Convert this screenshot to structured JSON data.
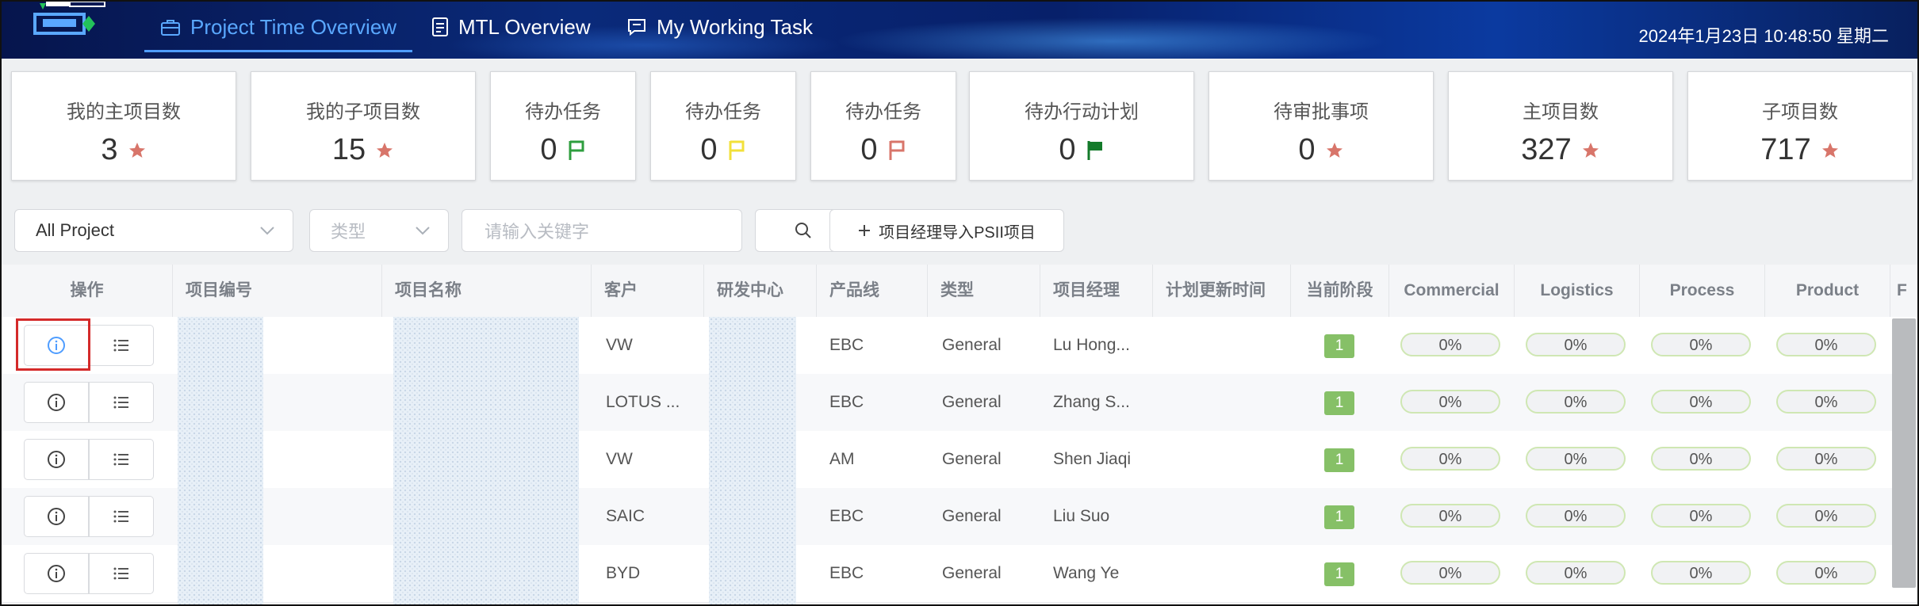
{
  "header": {
    "tabs": [
      {
        "label": "Project Time Overview",
        "icon": "briefcase-icon",
        "active": true
      },
      {
        "label": "MTL Overview",
        "icon": "document-icon",
        "active": false
      },
      {
        "label": "My Working Task",
        "icon": "chat-icon",
        "active": false
      }
    ],
    "datetime": "2024年1月23日  10:48:50  星期二"
  },
  "cards": [
    {
      "label": "我的主项目数",
      "value": "3",
      "icon": "star-icon",
      "color": "#d8756a"
    },
    {
      "label": "我的子项目数",
      "value": "15",
      "icon": "star-icon",
      "color": "#d8756a"
    },
    {
      "label": "待办任务",
      "value": "0",
      "icon": "flag-icon",
      "color": "#2e9e3e"
    },
    {
      "label": "待办任务",
      "value": "0",
      "icon": "flag-icon",
      "color": "#f2e03a"
    },
    {
      "label": "待办任务",
      "value": "0",
      "icon": "flag-icon",
      "color": "#d8756a"
    },
    {
      "label": "待办行动计划",
      "value": "0",
      "icon": "flag-solid-icon",
      "color": "#137a2a"
    },
    {
      "label": "待审批事项",
      "value": "0",
      "icon": "star-icon",
      "color": "#d8756a"
    },
    {
      "label": "主项目数",
      "value": "327",
      "icon": "star-icon",
      "color": "#d8756a"
    },
    {
      "label": "子项目数",
      "value": "717",
      "icon": "star-icon",
      "color": "#d8756a"
    }
  ],
  "filters": {
    "project_select": "All Project",
    "type_select_placeholder": "类型",
    "keyword_placeholder": "请输入关键字",
    "import_button": "项目经理导入PSII项目"
  },
  "table": {
    "columns": [
      "操作",
      "项目编号",
      "项目名称",
      "客户",
      "研发中心",
      "产品线",
      "类型",
      "项目经理",
      "计划更新时间",
      "当前阶段",
      "Commercial",
      "Logistics",
      "Process",
      "Product",
      "F"
    ],
    "rows": [
      {
        "customer": "VW",
        "product_line": "EBC",
        "type": "General",
        "manager": "Lu Hong...",
        "stage": "1",
        "commercial": "0%",
        "logistics": "0%",
        "process": "0%",
        "product": "0%"
      },
      {
        "customer": "LOTUS ...",
        "product_line": "EBC",
        "type": "General",
        "manager": "Zhang S...",
        "stage": "1",
        "commercial": "0%",
        "logistics": "0%",
        "process": "0%",
        "product": "0%"
      },
      {
        "customer": "VW",
        "product_line": "AM",
        "type": "General",
        "manager": "Shen Jiaqi",
        "stage": "1",
        "commercial": "0%",
        "logistics": "0%",
        "process": "0%",
        "product": "0%"
      },
      {
        "customer": "SAIC",
        "product_line": "EBC",
        "type": "General",
        "manager": "Liu Suo",
        "stage": "1",
        "commercial": "0%",
        "logistics": "0%",
        "process": "0%",
        "product": "0%"
      },
      {
        "customer": "BYD",
        "product_line": "EBC",
        "type": "General",
        "manager": "Wang Ye",
        "stage": "1",
        "commercial": "0%",
        "logistics": "0%",
        "process": "0%",
        "product": "0%"
      }
    ]
  },
  "colors": {
    "accent": "#4f9dff",
    "stage_badge": "#86c067",
    "highlight": "#d42a2a"
  }
}
